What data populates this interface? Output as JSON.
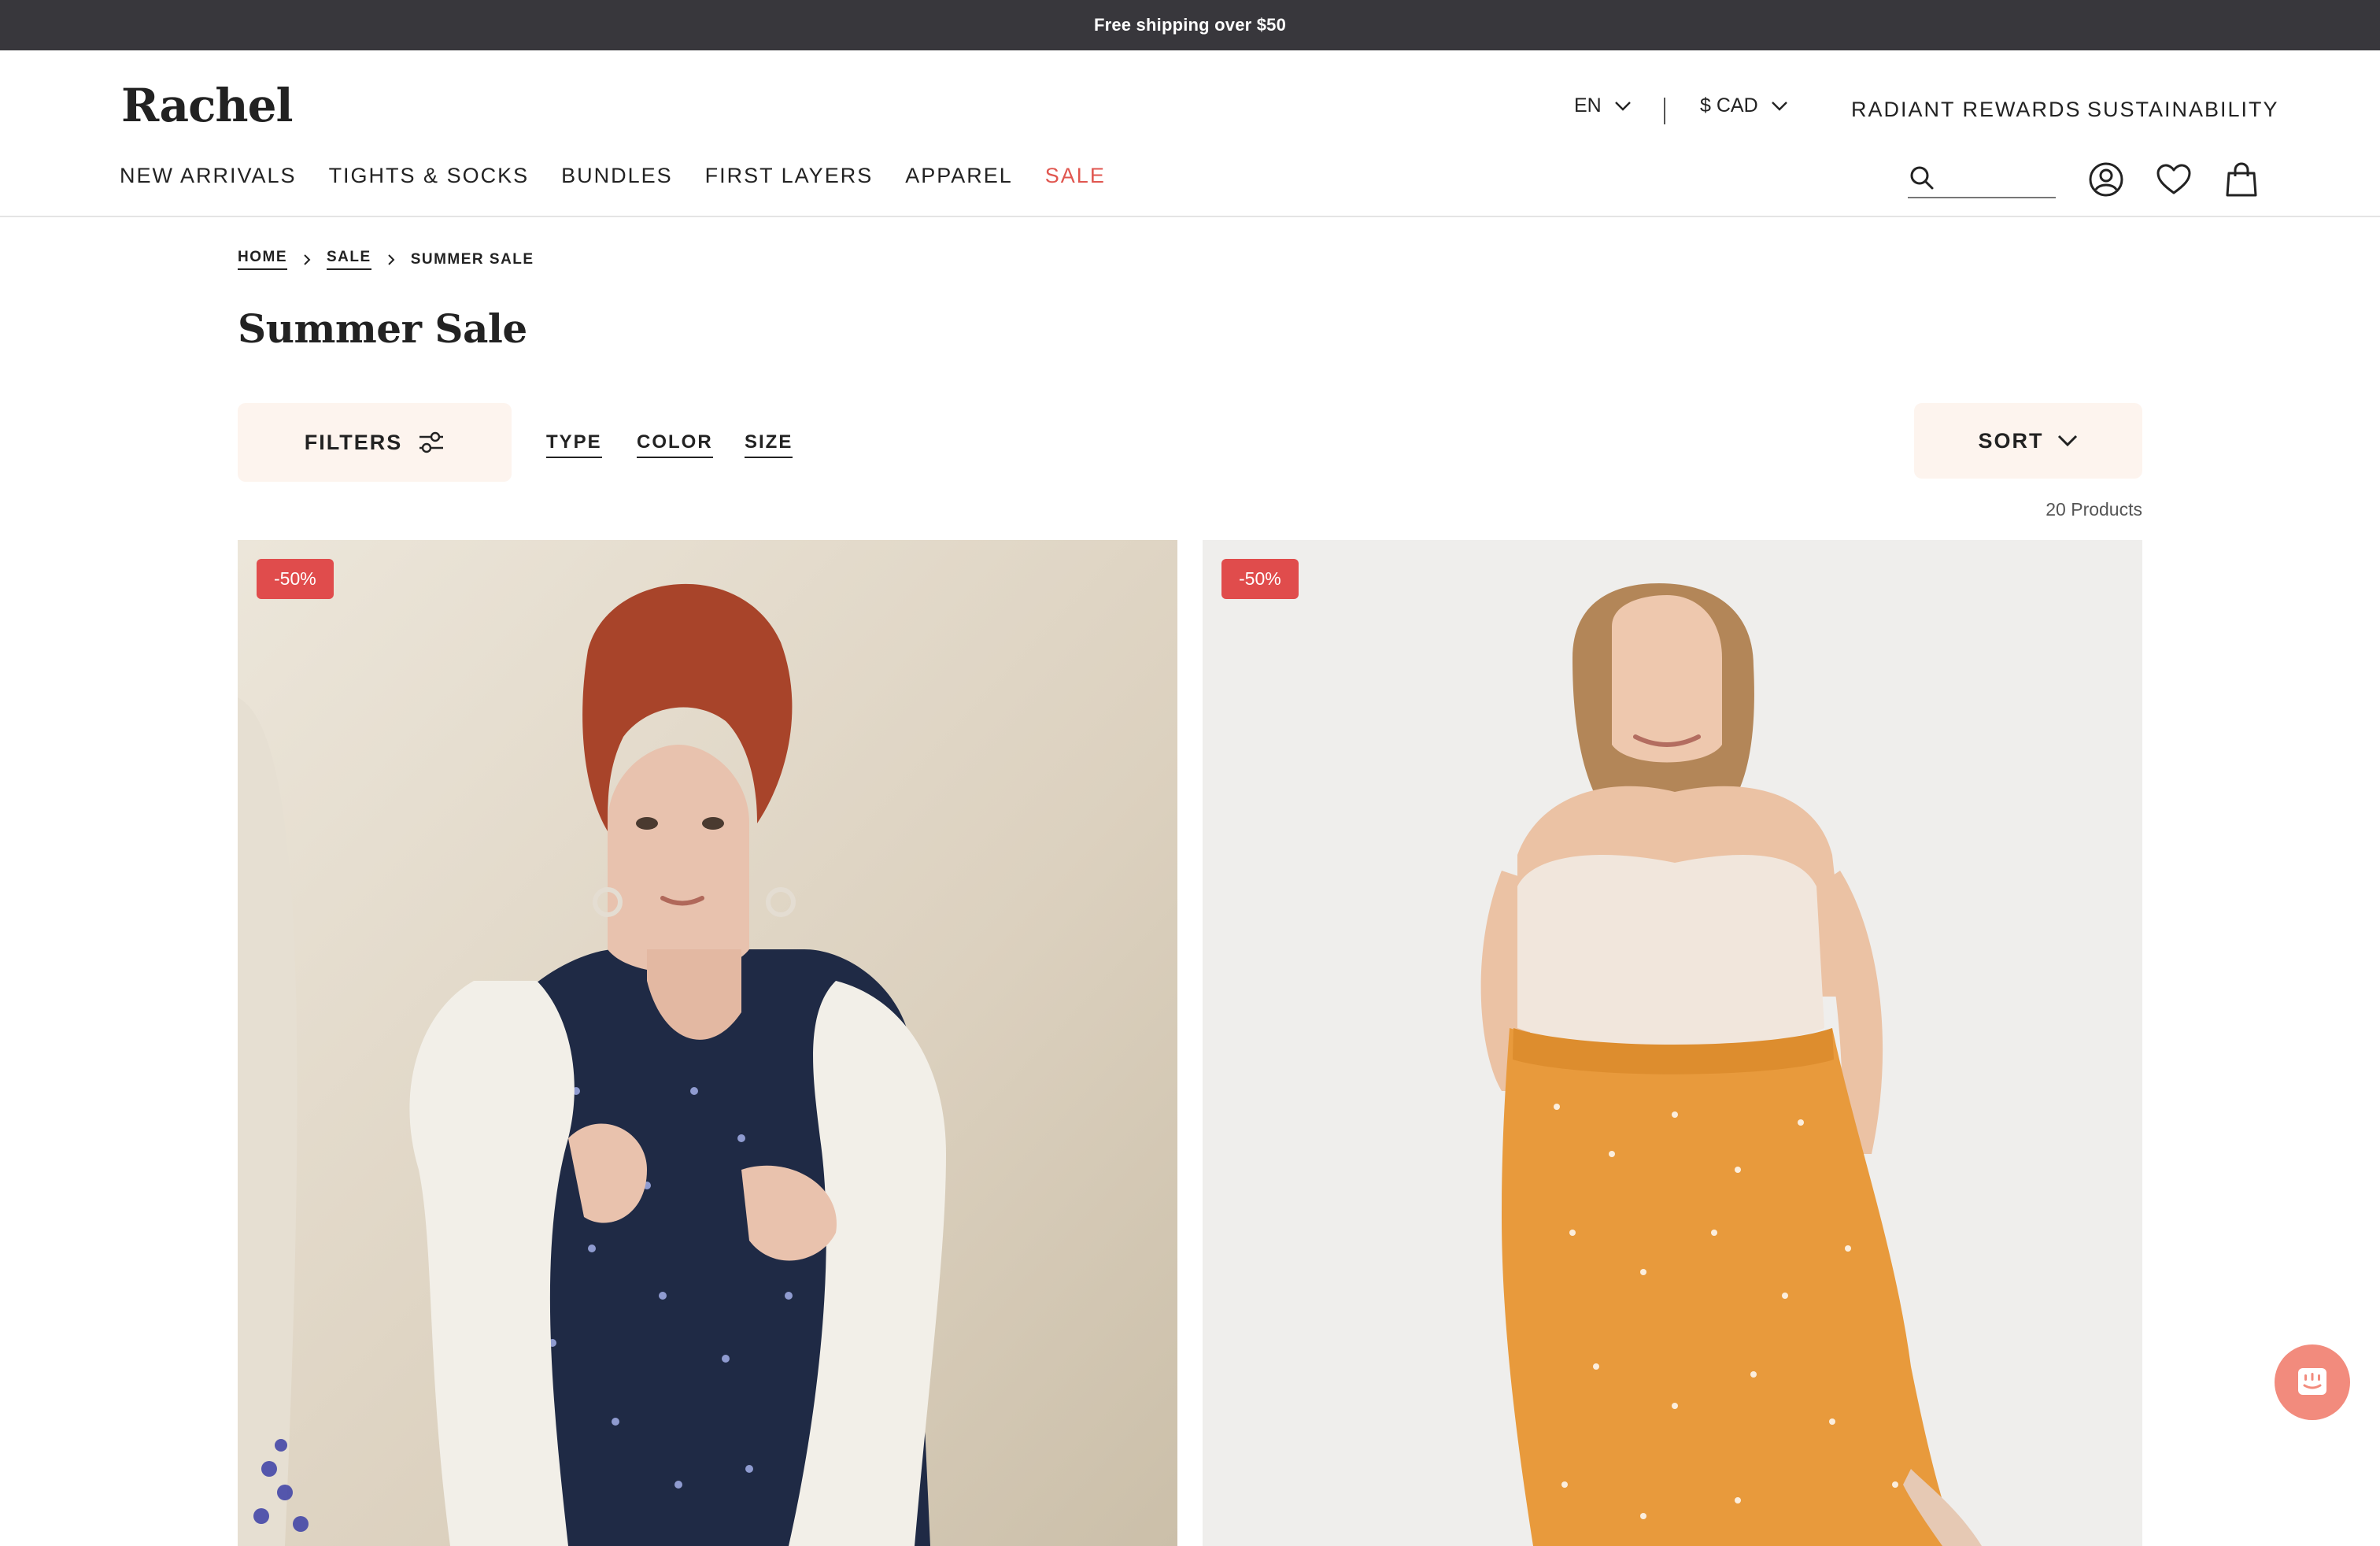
{
  "announcement": {
    "text": "Free shipping over $50"
  },
  "header": {
    "logo": "Rachel",
    "language": "EN",
    "currency": "$ CAD",
    "top_links": [
      "RADIANT REWARDS",
      "SUSTAINABILITY"
    ],
    "nav": [
      "NEW ARRIVALS",
      "TIGHTS & SOCKS",
      "BUNDLES",
      "FIRST LAYERS",
      "APPAREL",
      "SALE"
    ],
    "search": {
      "placeholder": "",
      "icon": "search-icon"
    },
    "icons": [
      "account-icon",
      "heart-icon",
      "shopping-bag-icon"
    ]
  },
  "breadcrumb": [
    "HOME",
    "SALE",
    "SUMMER SALE"
  ],
  "page": {
    "title": "Summer Sale",
    "filters_label": "FILTERS",
    "filter_links": [
      "TYPE",
      "COLOR",
      "SIZE"
    ],
    "sort_label": "SORT",
    "product_count": "20 Products"
  },
  "products": [
    {
      "badge": "-50%",
      "image": "woman in navy floral dress with white sweater over shoulders"
    },
    {
      "badge": "-50%",
      "image": "woman in cream top and orange polka dot midi skirt"
    }
  ],
  "colors": {
    "announcement_bg": "#38373c",
    "sale_accent": "#e0564f",
    "badge_bg": "#e04c4c",
    "button_bg": "#fdf4ee",
    "chat_bg": "#f28b7d"
  },
  "chat": {
    "icon": "chat-icon"
  }
}
